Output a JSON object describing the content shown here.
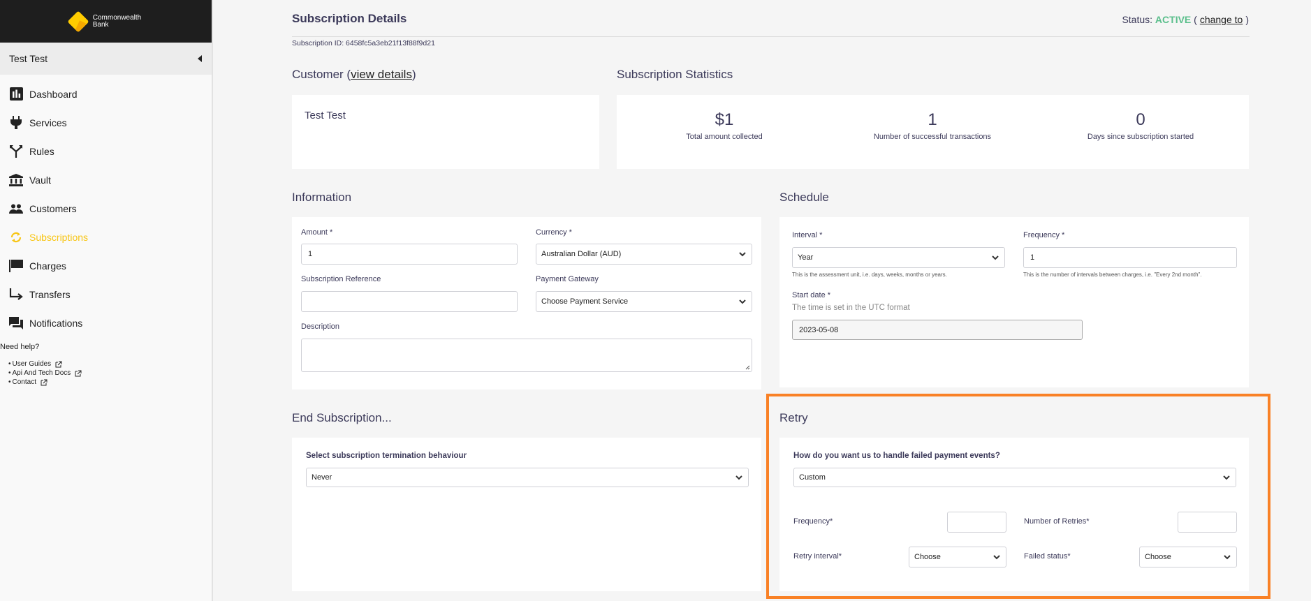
{
  "brand": {
    "name_line1": "Commonwealth",
    "name_line2": "Bank"
  },
  "sidebar": {
    "user_name": "Test Test",
    "items": [
      {
        "label": "Dashboard",
        "icon": "dashboard-icon"
      },
      {
        "label": "Services",
        "icon": "plug-icon"
      },
      {
        "label": "Rules",
        "icon": "split-icon"
      },
      {
        "label": "Vault",
        "icon": "bank-icon"
      },
      {
        "label": "Customers",
        "icon": "people-icon"
      },
      {
        "label": "Subscriptions",
        "icon": "sync-icon",
        "active": true
      },
      {
        "label": "Charges",
        "icon": "flag-icon"
      },
      {
        "label": "Transfers",
        "icon": "transfer-arrow-icon"
      },
      {
        "label": "Notifications",
        "icon": "chat-icon"
      }
    ],
    "help_title": "Need help?",
    "help_links": [
      "User Guides",
      "Api And Tech Docs",
      "Contact"
    ],
    "active_color": "#f8c617"
  },
  "header": {
    "title": "Subscription Details",
    "status_label": "Status:",
    "status_value": "ACTIVE",
    "status_color": "#5bbf8c",
    "open_paren": "(",
    "change_link": "change to",
    "close_paren": ")",
    "subscription_id": "Subscription ID: 6458fc5a3eb21f13f88f9d21"
  },
  "customer": {
    "title": "Customer (",
    "view_details": "view details",
    "title_close": ")",
    "name": "Test Test"
  },
  "stats": {
    "title": "Subscription Statistics",
    "items": [
      {
        "value": "$1",
        "label": "Total amount collected"
      },
      {
        "value": "1",
        "label": "Number of successful transactions"
      },
      {
        "value": "0",
        "label": "Days since subscription started"
      }
    ]
  },
  "information": {
    "title": "Information",
    "amount_label": "Amount *",
    "amount_value": "1",
    "currency_label": "Currency *",
    "currency_value": "Australian Dollar (AUD)",
    "reference_label": "Subscription Reference",
    "reference_value": "",
    "gateway_label": "Payment Gateway",
    "gateway_value": "Choose Payment Service",
    "description_label": "Description",
    "description_value": ""
  },
  "schedule": {
    "title": "Schedule",
    "interval_label": "Interval *",
    "interval_value": "Year",
    "interval_hint": "This is the assessment unit, i.e. days, weeks, months or years.",
    "frequency_label": "Frequency *",
    "frequency_value": "1",
    "frequency_hint": "This is the number of intervals between charges, i.e. \"Every 2nd month\".",
    "start_label": "Start date *",
    "start_hint": "The time is set in the UTC format",
    "start_value": "2023-05-08"
  },
  "end_subscription": {
    "title": "End Subscription...",
    "label": "Select subscription termination behaviour",
    "value": "Never"
  },
  "retry": {
    "title": "Retry",
    "question": "How do you want us to handle failed payment events?",
    "mode_value": "Custom",
    "frequency_label": "Frequency*",
    "frequency_value": "",
    "retries_label": "Number of Retries*",
    "retries_value": "",
    "interval_label": "Retry interval*",
    "interval_value": "Choose",
    "failed_status_label": "Failed status*",
    "failed_status_value": "Choose",
    "highlight_color": "#f98126"
  }
}
